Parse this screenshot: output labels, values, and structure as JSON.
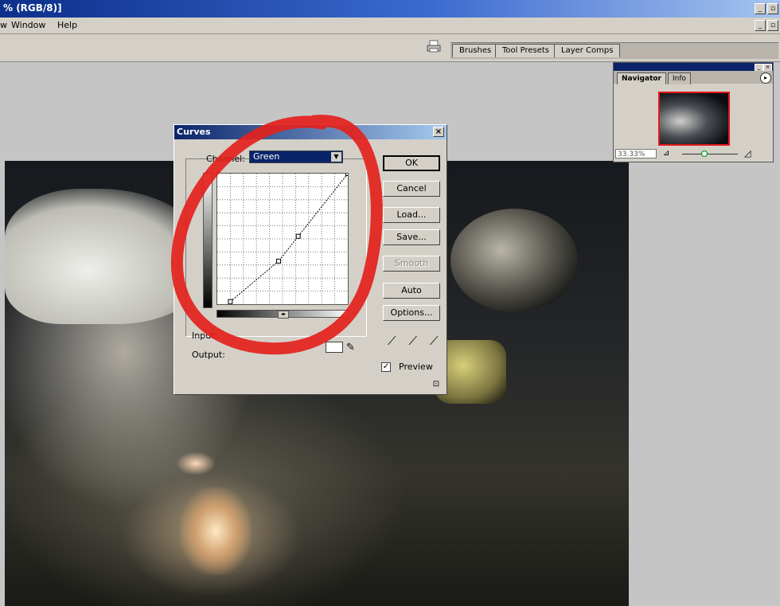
{
  "window": {
    "title": "% (RGB/8)]",
    "buttons": [
      "_",
      "▫",
      "×"
    ],
    "doc_buttons": [
      "_",
      "▫",
      "×"
    ]
  },
  "menubar": {
    "items": [
      "w",
      "Window",
      "Help"
    ]
  },
  "optionsbar": {
    "palette_tabs": [
      "Brushes",
      "Tool Presets",
      "Layer Comps"
    ]
  },
  "navigator": {
    "tabs": [
      "Navigator",
      "Info"
    ],
    "zoom": "33.33%",
    "menu_arrow": "▸"
  },
  "curves_dialog": {
    "title": "Curves",
    "close_label": "×",
    "channel_label": "Channel:",
    "channel_value": "Green",
    "input_label": "Input:",
    "output_label": "Output:",
    "input_value": "",
    "buttons": {
      "ok": "OK",
      "cancel": "Cancel",
      "load": "Load...",
      "save": "Save...",
      "smooth": "Smooth",
      "auto": "Auto",
      "options": "Options..."
    },
    "preview_label": "Preview",
    "preview_checked": true,
    "curve_points": [
      [
        0.1,
        0.02
      ],
      [
        0.47,
        0.33
      ],
      [
        0.62,
        0.52
      ],
      [
        1.0,
        1.0
      ]
    ]
  },
  "annotation": {
    "color": "#e3211c"
  },
  "colors": {
    "titlebar_start": "#0b2f8a",
    "dialog_bg": "#d4d0c8",
    "selection": "#0a246a"
  }
}
